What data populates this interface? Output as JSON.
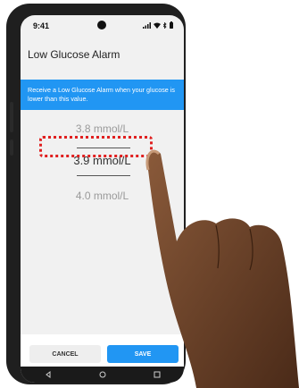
{
  "status": {
    "time": "9:41",
    "icons": [
      "signal-icon",
      "wifi-icon",
      "bluetooth-icon",
      "battery-icon"
    ]
  },
  "appbar": {
    "title": "Low Glucose Alarm"
  },
  "banner": {
    "text": "Receive a Low Glucose Alarm when your glucose is lower than this value."
  },
  "picker": {
    "prev": "3.8 mmol/L",
    "selected": "3.9 mmol/L",
    "next": "4.0 mmol/L"
  },
  "actions": {
    "cancel": "CANCEL",
    "save": "SAVE"
  },
  "nav": [
    "back-icon",
    "home-icon",
    "recents-icon"
  ],
  "colors": {
    "accent": "#2196f3",
    "highlight": "#e02020",
    "screen_bg": "#f1f1f1"
  }
}
